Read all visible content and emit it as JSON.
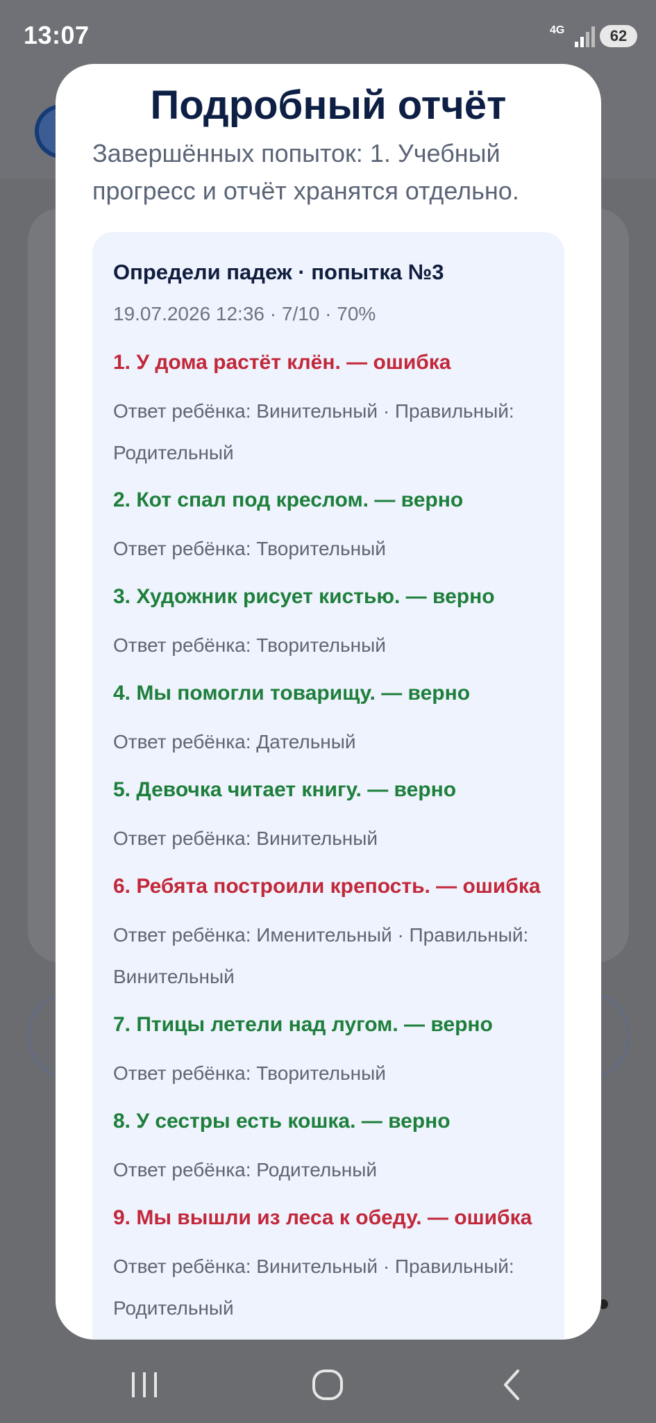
{
  "status_bar": {
    "time": "13:07",
    "network": "4G",
    "battery": "62"
  },
  "modal": {
    "title": "Подробный отчёт",
    "subtitle": "Завершённых попыток: 1. Учебный прогресс и отчёт хранятся отдельно.",
    "attempt": {
      "title": "Определи падеж · попытка №3",
      "meta": "19.07.2026 12:36 · 7/10 · 70%"
    },
    "items": [
      {
        "status": "err",
        "head": "1. У дома растёт клён. — ошибка",
        "detail": "Ответ ребёнка: Винительный · Правильный: Родительный"
      },
      {
        "status": "ok",
        "head": "2. Кот спал под креслом. — верно",
        "detail": "Ответ ребёнка: Творительный"
      },
      {
        "status": "ok",
        "head": "3. Художник рисует кистью. — верно",
        "detail": "Ответ ребёнка: Творительный"
      },
      {
        "status": "ok",
        "head": "4. Мы помогли товарищу. — верно",
        "detail": "Ответ ребёнка: Дательный"
      },
      {
        "status": "ok",
        "head": "5. Девочка читает книгу. — верно",
        "detail": "Ответ ребёнка: Винительный"
      },
      {
        "status": "err",
        "head": "6. Ребята построили крепость. — ошибка",
        "detail": "Ответ ребёнка: Именительный · Правильный: Винительный"
      },
      {
        "status": "ok",
        "head": "7. Птицы летели над лугом. — верно",
        "detail": "Ответ ребёнка: Творительный"
      },
      {
        "status": "ok",
        "head": "8. У сестры есть кошка. — верно",
        "detail": "Ответ ребёнка: Родительный"
      },
      {
        "status": "err",
        "head": "9. Мы вышли из леса к обеду. — ошибка",
        "detail": "Ответ ребёнка: Винительный · Правильный: Родительный"
      }
    ]
  },
  "colors": {
    "correct": "#1e7f3b",
    "error": "#c2283a",
    "title": "#0e1f45",
    "card": "#eef3fd"
  },
  "nav": {
    "recents_icon": "recents-icon",
    "home_icon": "home-icon",
    "back_icon": "back-icon"
  }
}
